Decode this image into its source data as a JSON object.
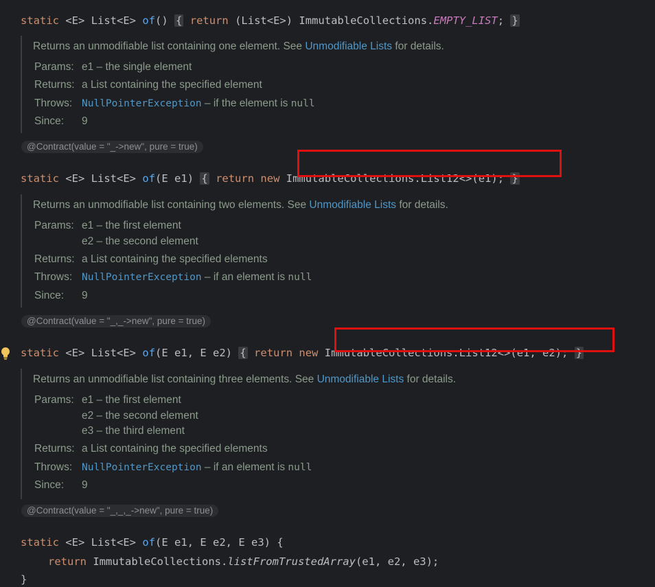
{
  "line0": {
    "kw_static": "static",
    "generic": "<E>",
    "type_list": "List<E>",
    "method": "of",
    "parens": "()",
    "open_brace": "{",
    "kw_return": "return",
    "cast": "(List<E>)",
    "class_ref": "ImmutableCollections.",
    "constant": "EMPTY_LIST",
    "semi": ";",
    "close_brace": "}"
  },
  "doc1": {
    "desc_prefix": "Returns an unmodifiable list containing one element. See ",
    "link": "Unmodifiable Lists",
    "desc_suffix": " for details.",
    "params_label": "Params:",
    "params": [
      "e1 – the single element"
    ],
    "returns_label": "Returns:",
    "returns_prefix": "a ",
    "returns_code": "List",
    "returns_suffix": " containing the specified element",
    "throws_label": "Throws:",
    "throws_link": "NullPointerException",
    "throws_mid": " – if the element is ",
    "throws_code": "null",
    "since_label": "Since:",
    "since_value": "9"
  },
  "anno1": "@Contract(value = \"_->new\", pure = true)",
  "line1": {
    "kw_static": "static",
    "generic": "<E>",
    "type_list": "List<E>",
    "method": "of",
    "params": "(E e1)",
    "open_brace": "{",
    "kw_return": "return",
    "kw_new": "new",
    "body": "ImmutableCollections.List12<>(e1);",
    "close_brace": "}"
  },
  "doc2": {
    "desc_prefix": "Returns an unmodifiable list containing two elements. See ",
    "link": "Unmodifiable Lists",
    "desc_suffix": " for details.",
    "params_label": "Params:",
    "params": [
      "e1 – the first element",
      "e2 – the second element"
    ],
    "returns_label": "Returns:",
    "returns_prefix": "a ",
    "returns_code": "List",
    "returns_suffix": " containing the specified elements",
    "throws_label": "Throws:",
    "throws_link": "NullPointerException",
    "throws_mid": " – if an element is ",
    "throws_code": "null",
    "since_label": "Since:",
    "since_value": "9"
  },
  "anno2": "@Contract(value = \"_,_->new\", pure = true)",
  "line2": {
    "kw_static": "static",
    "generic": "<E>",
    "type_list": "List<E>",
    "method": "of",
    "params": "(E e1, E e2)",
    "open_brace": "{",
    "kw_return": "return",
    "kw_new": "new",
    "body": "ImmutableCollections.List12<>(e1, e2);",
    "close_brace": "}"
  },
  "doc3": {
    "desc_prefix": "Returns an unmodifiable list containing three elements. See ",
    "link": "Unmodifiable Lists",
    "desc_suffix": " for details.",
    "params_label": "Params:",
    "params": [
      "e1 – the first element",
      "e2 – the second element",
      "e3 – the third element"
    ],
    "returns_label": "Returns:",
    "returns_prefix": "a ",
    "returns_code": "List",
    "returns_suffix": " containing the specified elements",
    "throws_label": "Throws:",
    "throws_link": "NullPointerException",
    "throws_mid": " – if an element is ",
    "throws_code": "null",
    "since_label": "Since:",
    "since_value": "9"
  },
  "anno3": "@Contract(value = \"_,_,_->new\", pure = true)",
  "line3": {
    "kw_static": "static",
    "generic": "<E>",
    "type_list": "List<E>",
    "method": "of",
    "params": "(E e1, E e2, E e3)",
    "open_brace": "{",
    "kw_return": "return",
    "body_class": "ImmutableCollections.",
    "body_method": "listFromTrustedArray",
    "body_args": "(e1, e2, e3);",
    "close_brace": "}"
  },
  "icons": {
    "intention": "lightbulb-icon"
  },
  "colors": {
    "highlight_box": "#e01010",
    "background": "#1e1f22"
  }
}
